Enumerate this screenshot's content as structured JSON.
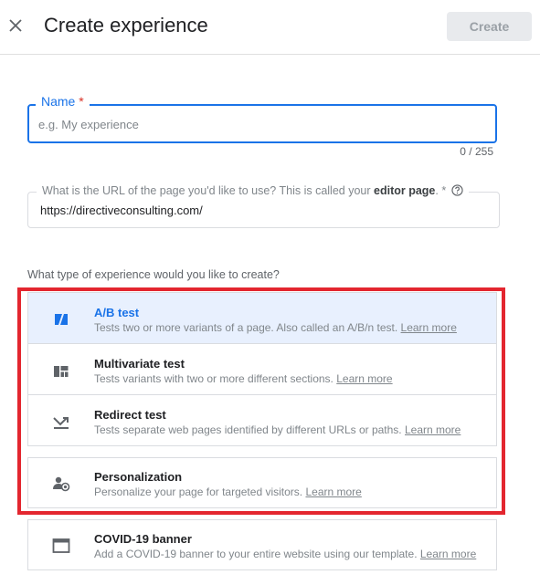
{
  "header": {
    "title": "Create experience",
    "create_label": "Create"
  },
  "name_field": {
    "label": "Name",
    "required_mark": "*",
    "placeholder": "e.g. My experience",
    "counter": "0 / 255"
  },
  "url_field": {
    "label_prefix": "What is the URL of the page you'd like to use? This is called your",
    "label_strong": "editor page",
    "label_suffix": ". *",
    "value": "https://directiveconsulting.com/"
  },
  "experience_type": {
    "question": "What type of experience would you like to create?",
    "options": [
      {
        "title": "A/B test",
        "desc": "Tests two or more variants of a page. Also called an A/B/n test.",
        "link": "Learn more",
        "icon": "ab-test-icon",
        "selected": true
      },
      {
        "title": "Multivariate test",
        "desc": "Tests variants with two or more different sections.",
        "link": "Learn more",
        "icon": "multivariate-icon",
        "selected": false
      },
      {
        "title": "Redirect test",
        "desc": "Tests separate web pages identified by different URLs or paths.",
        "link": "Learn more",
        "icon": "redirect-icon",
        "selected": false
      },
      {
        "title": "Personalization",
        "desc": "Personalize your page for targeted visitors.",
        "link": "Learn more",
        "icon": "personalization-icon",
        "selected": false
      },
      {
        "title": "COVID-19 banner",
        "desc": "Add a COVID-19 banner to your entire website using our template.",
        "link": "Learn more",
        "icon": "banner-icon",
        "selected": false
      }
    ]
  },
  "colors": {
    "accent": "#1a73e8",
    "selected_bg": "#e8f0fe",
    "highlight": "#e3262f",
    "required": "#d93025"
  }
}
